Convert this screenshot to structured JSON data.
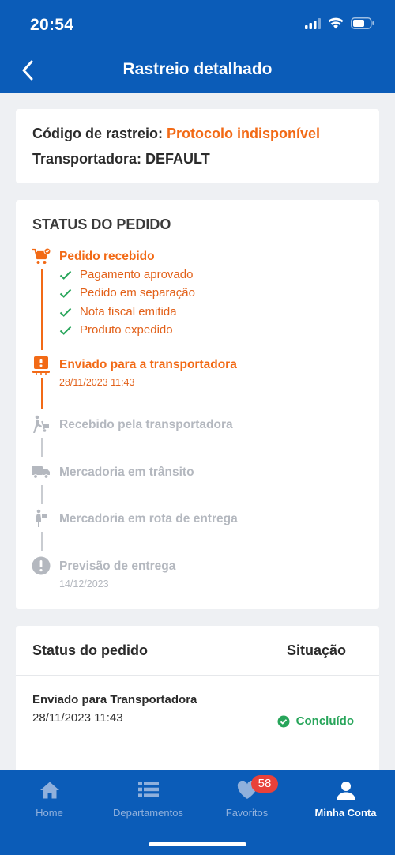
{
  "status_bar": {
    "time": "20:54"
  },
  "header": {
    "title": "Rastreio detalhado"
  },
  "tracking": {
    "code_label": "Código de rastreio:",
    "code_value": "Protocolo indisponível",
    "carrier_label": "Transportadora:",
    "carrier_value": "DEFAULT"
  },
  "order_status": {
    "heading": "STATUS DO PEDIDO",
    "steps": [
      {
        "label": "Pedido recebido",
        "icon": "cart-icon",
        "state": "active",
        "substeps": [
          "Pagamento aprovado",
          "Pedido em separação",
          "Nota fiscal emitida",
          "Produto expedido"
        ]
      },
      {
        "label": "Enviado para a transportadora",
        "date": "28/11/2023 11:43",
        "icon": "package-icon",
        "state": "active"
      },
      {
        "label": "Recebido pela transportadora",
        "icon": "hand-truck-icon",
        "state": "inactive"
      },
      {
        "label": "Mercadoria em trânsito",
        "icon": "truck-icon",
        "state": "inactive"
      },
      {
        "label": "Mercadoria em rota de entrega",
        "icon": "delivery-person-icon",
        "state": "inactive"
      },
      {
        "label": "Previsão de entrega",
        "date": "14/12/2023",
        "icon": "exclamation-icon",
        "state": "inactive"
      }
    ]
  },
  "history": {
    "col_status": "Status do pedido",
    "col_situation": "Situação",
    "rows": [
      {
        "title": "Enviado para Transportadora",
        "date": "28/11/2023 11:43",
        "status": "Concluído"
      }
    ]
  },
  "tabbar": {
    "tabs": [
      {
        "label": "Home",
        "icon": "home-icon"
      },
      {
        "label": "Departamentos",
        "icon": "list-icon"
      },
      {
        "label": "Favoritos",
        "icon": "heart-icon",
        "badge": "58"
      },
      {
        "label": "Minha Conta",
        "icon": "user-icon",
        "active": true
      }
    ]
  },
  "colors": {
    "brand_blue": "#0b5cb8",
    "accent_orange": "#f26a16",
    "success_green": "#27a55a",
    "badge_red": "#e8413a",
    "inactive_grey": "#b4b8bf"
  }
}
